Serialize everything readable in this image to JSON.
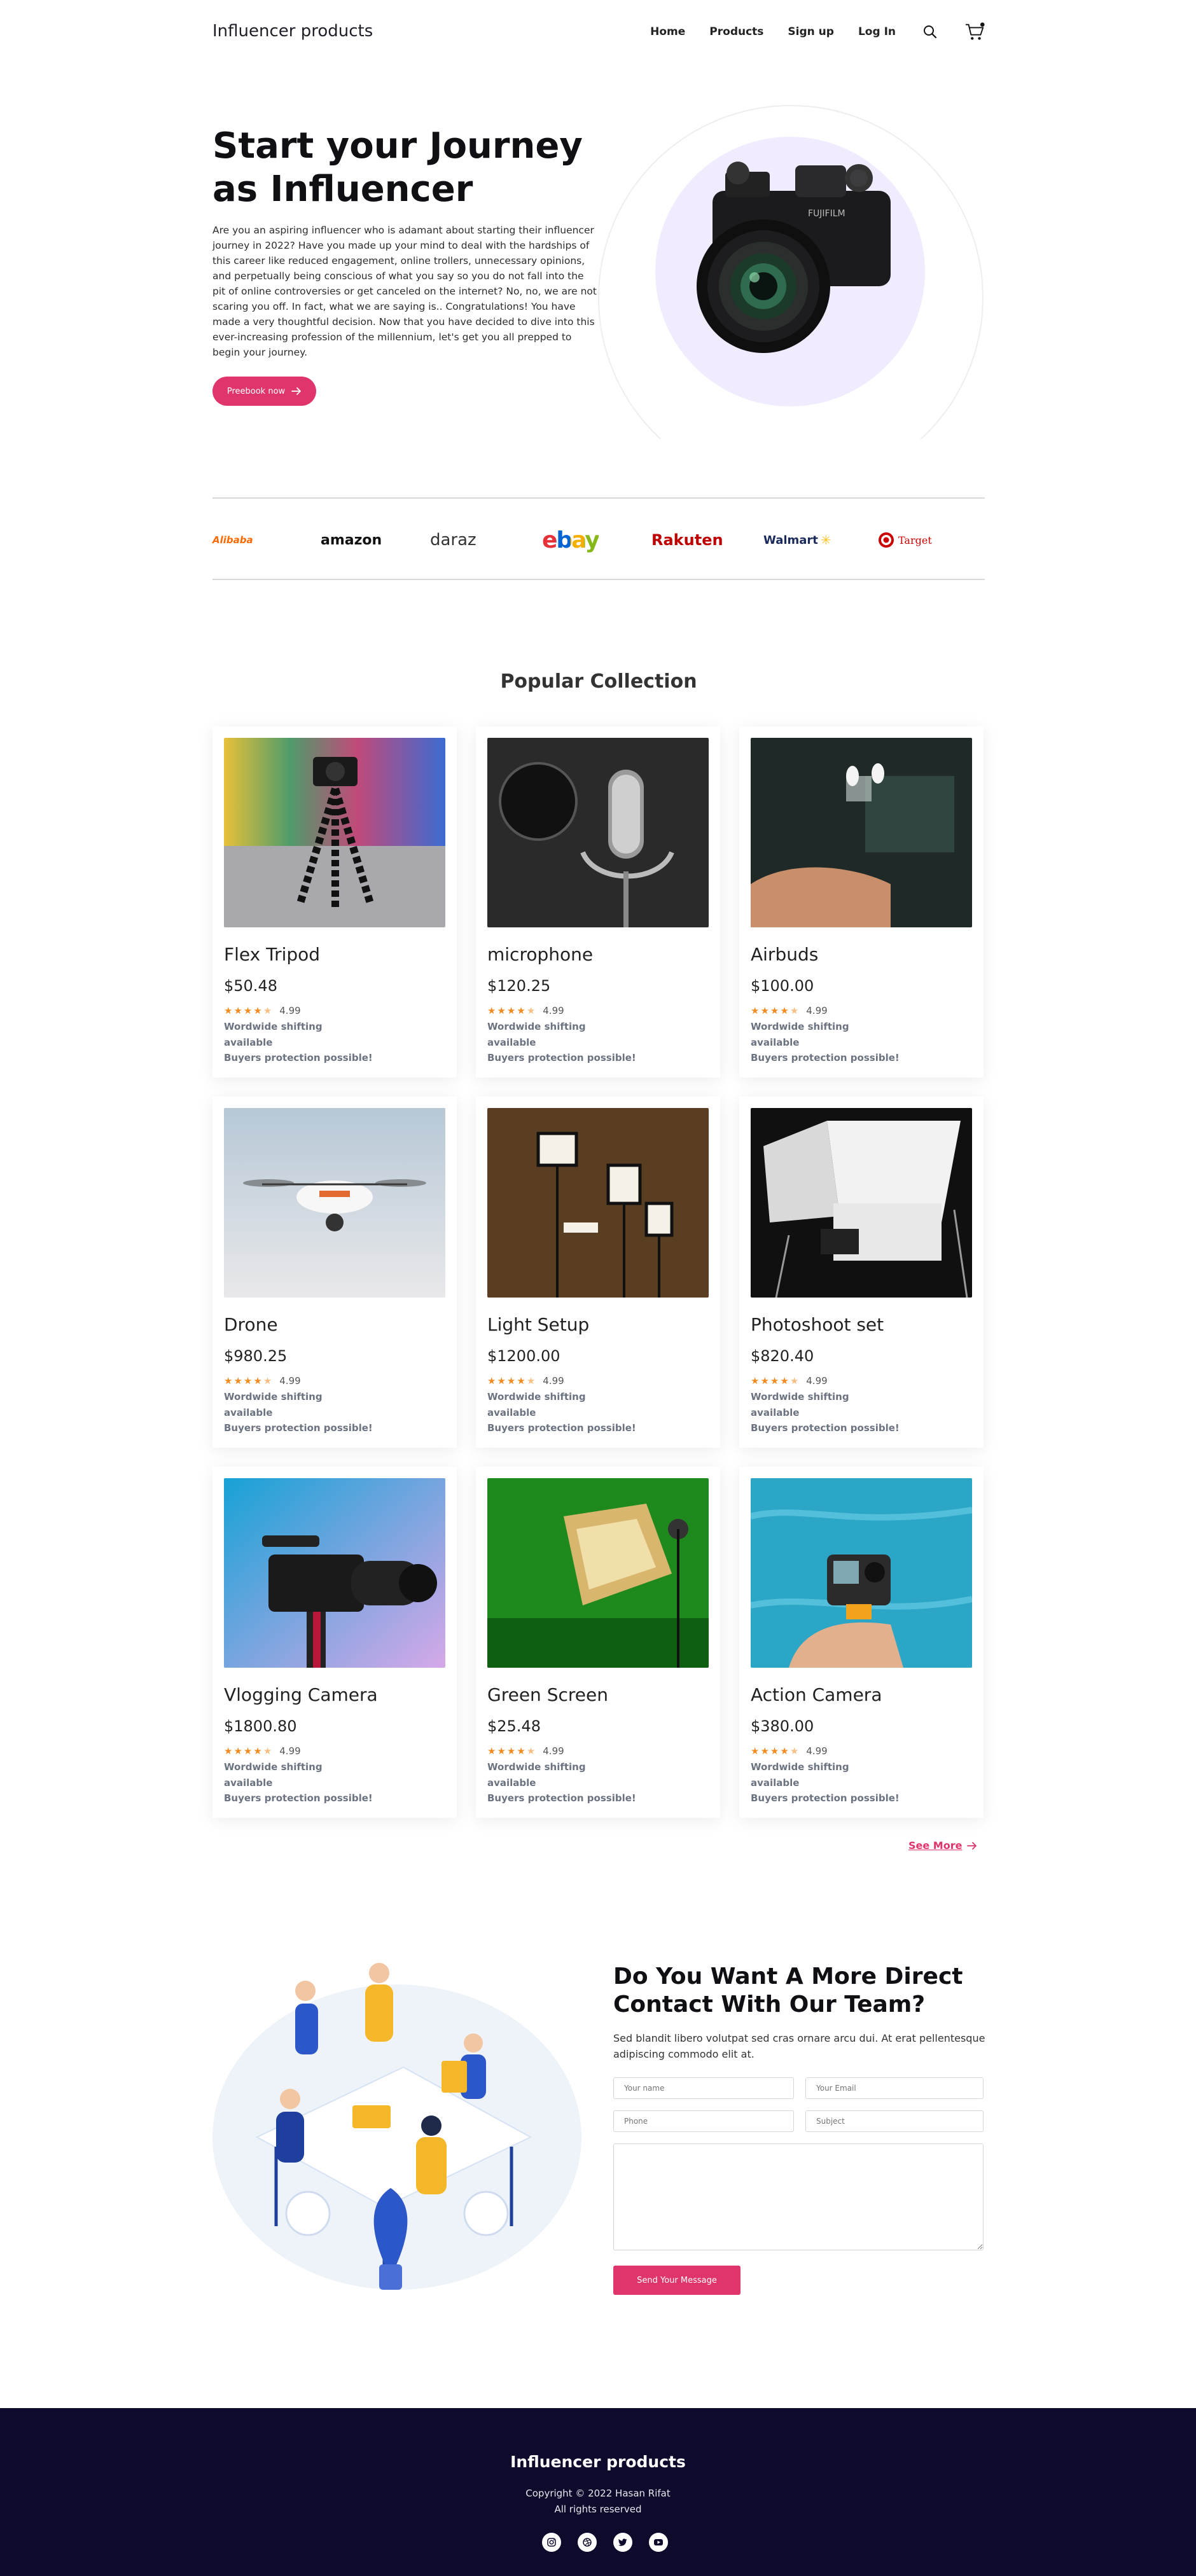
{
  "nav": {
    "brand": "Influencer products",
    "links": [
      "Home",
      "Products",
      "Sign up",
      "Log In"
    ],
    "icons": [
      "search-icon",
      "cart-icon"
    ]
  },
  "hero": {
    "title": "Start your Journey as Influencer",
    "text": "Are you an aspiring influencer who is adamant about starting their influencer journey in 2022? Have you made up your mind to deal with the hardships of this career like reduced engagement, online trollers, unnecessary opinions, and perpetually being conscious of what you say so you do not fall into the pit of online controversies or get canceled on the internet? No, no, we are not scaring you off. In fact, what we are saying is.. Congratulations! You have made a very thoughtful decision. Now that you have decided to dive into this ever-increasing profession of the millennium, let's get you all prepped to begin your journey.",
    "button": "Preebook now"
  },
  "brands": [
    "Alibaba",
    "amazon",
    "daraz",
    "ebay",
    "Rakuten",
    "Walmart",
    "Target"
  ],
  "collection": {
    "title": "Popular Collection",
    "products": [
      {
        "name": "Flex Tripod",
        "price": "$50.48",
        "rating": "4.99",
        "shipping": "Wordwide shifting available",
        "protection": "Buyers protection possible!"
      },
      {
        "name": "microphone",
        "price": "$120.25",
        "rating": "4.99",
        "shipping": "Wordwide shifting available",
        "protection": "Buyers protection possible!"
      },
      {
        "name": "Airbuds",
        "price": "$100.00",
        "rating": "4.99",
        "shipping": "Wordwide shifting available",
        "protection": "Buyers protection possible!"
      },
      {
        "name": "Drone",
        "price": "$980.25",
        "rating": "4.99",
        "shipping": "Wordwide shifting available",
        "protection": "Buyers protection possible!"
      },
      {
        "name": "Light Setup",
        "price": "$1200.00",
        "rating": "4.99",
        "shipping": "Wordwide shifting available",
        "protection": "Buyers protection possible!"
      },
      {
        "name": "Photoshoot set",
        "price": "$820.40",
        "rating": "4.99",
        "shipping": "Wordwide shifting available",
        "protection": "Buyers protection possible!"
      },
      {
        "name": "Vlogging Camera",
        "price": "$1800.80",
        "rating": "4.99",
        "shipping": "Wordwide shifting available",
        "protection": "Buyers protection possible!"
      },
      {
        "name": "Green Screen",
        "price": "$25.48",
        "rating": "4.99",
        "shipping": "Wordwide shifting available",
        "protection": "Buyers protection possible!"
      },
      {
        "name": "Action Camera",
        "price": "$380.00",
        "rating": "4.99",
        "shipping": "Wordwide shifting available",
        "protection": "Buyers protection possible!"
      }
    ],
    "see_more": "See More"
  },
  "contact": {
    "title": "Do You Want A More Direct Contact With Our Team?",
    "text": "Sed blandit libero volutpat sed cras ornare arcu dui. At erat pellentesque adipiscing commodo elit at.",
    "placeholders": {
      "name": "Your name",
      "email": "Your Email",
      "phone": "Phone",
      "subject": "Subject"
    },
    "button": "Send Your Message"
  },
  "footer": {
    "brand": "Influencer products",
    "copyright": "Copyright © 2022 Hasan Rifat",
    "rights": "All rights reserved",
    "social_icons": [
      "instagram-icon",
      "dribbble-icon",
      "twitter-icon",
      "youtube-icon"
    ]
  },
  "colors": {
    "accent": "#e0356a",
    "footer_bg": "#0d0a2b",
    "hero_disc": "#f1ebff",
    "star": "#f28b20"
  }
}
